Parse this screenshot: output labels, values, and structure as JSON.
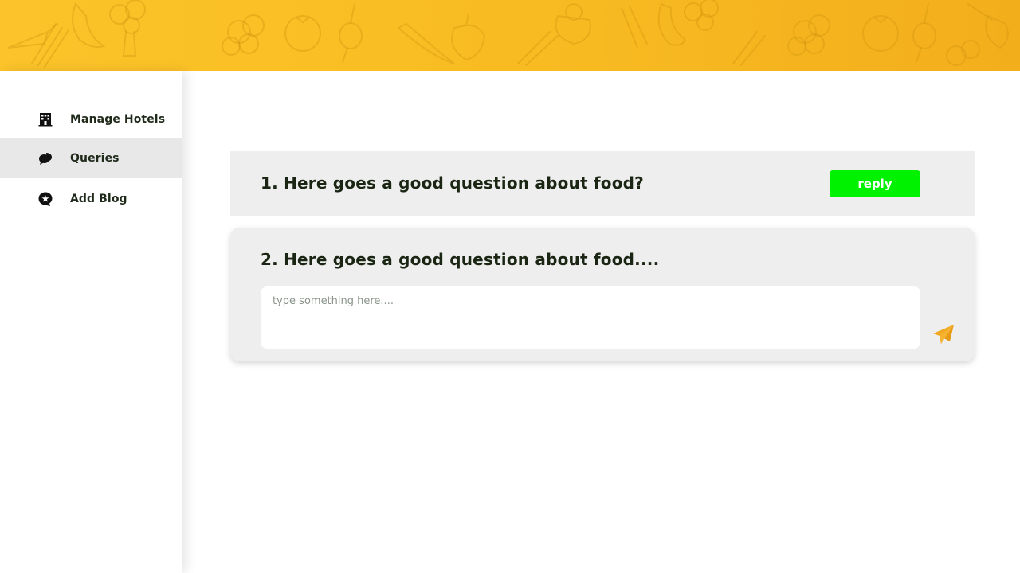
{
  "header": {
    "pattern_icons": [
      "chili-icon",
      "broccoli-icon",
      "tomato-icon",
      "onion-icon",
      "pepper-icon",
      "cauliflower-icon",
      "carrot-icon",
      "scallion-icon",
      "eggplant-icon",
      "cucumber-icon"
    ]
  },
  "sidebar": {
    "items": [
      {
        "label": "Manage Hotels",
        "icon": "hotel-icon",
        "active": false
      },
      {
        "label": "Queries",
        "icon": "chat-icon",
        "active": true
      },
      {
        "label": "Add Blog",
        "icon": "star-chat-icon",
        "active": false
      }
    ]
  },
  "queries": [
    {
      "question": "1. Here goes a good question about food?",
      "reply_label": "reply"
    },
    {
      "question": "2. Here goes a good question about food....",
      "placeholder": "type something here....",
      "send_icon": "send-icon"
    }
  ],
  "colors": {
    "header_start": "#fcc42a",
    "header_end": "#f3ae1c",
    "reply_button": "#00f200",
    "send_icon": "#f2a922",
    "card_bg": "#eeeeee",
    "active_nav_bg": "#e8e8e8",
    "text_dark": "#1a2613"
  }
}
